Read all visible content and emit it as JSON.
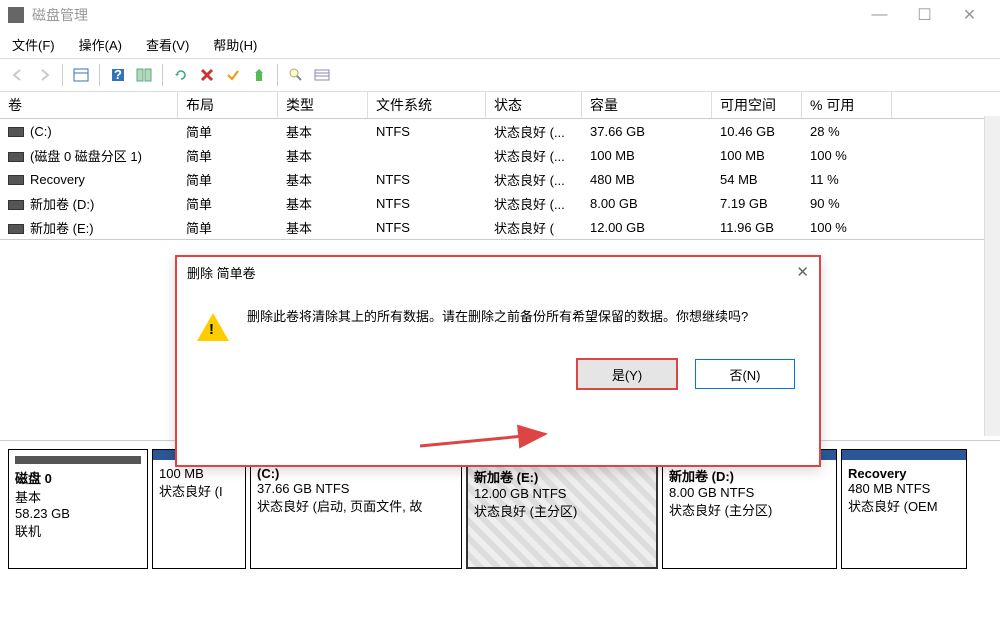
{
  "window": {
    "title": "磁盘管理"
  },
  "menu": {
    "file": "文件(F)",
    "action": "操作(A)",
    "view": "查看(V)",
    "help": "帮助(H)"
  },
  "columns": {
    "vol": "卷",
    "layout": "布局",
    "type": "类型",
    "fs": "文件系统",
    "status": "状态",
    "cap": "容量",
    "free": "可用空间",
    "pct": "% 可用"
  },
  "rows": [
    {
      "vol": "(C:)",
      "layout": "简单",
      "type": "基本",
      "fs": "NTFS",
      "status": "状态良好 (...",
      "cap": "37.66 GB",
      "free": "10.46 GB",
      "pct": "28 %"
    },
    {
      "vol": "(磁盘 0 磁盘分区 1)",
      "layout": "简单",
      "type": "基本",
      "fs": "",
      "status": "状态良好 (...",
      "cap": "100 MB",
      "free": "100 MB",
      "pct": "100 %"
    },
    {
      "vol": "Recovery",
      "layout": "简单",
      "type": "基本",
      "fs": "NTFS",
      "status": "状态良好 (...",
      "cap": "480 MB",
      "free": "54 MB",
      "pct": "11 %"
    },
    {
      "vol": "新加卷 (D:)",
      "layout": "简单",
      "type": "基本",
      "fs": "NTFS",
      "status": "状态良好 (...",
      "cap": "8.00 GB",
      "free": "7.19 GB",
      "pct": "90 %"
    },
    {
      "vol": "新加卷 (E:)",
      "layout": "简单",
      "type": "基本",
      "fs": "NTFS",
      "status": "状态良好 (",
      "cap": "12.00 GB",
      "free": "11.96 GB",
      "pct": "100 %"
    }
  ],
  "disk": {
    "label": "磁盘 0",
    "type": "基本",
    "size": "58.23 GB",
    "state": "联机",
    "parts": [
      {
        "title": "",
        "line1": "100 MB",
        "line2": "状态良好 (I"
      },
      {
        "title": "(C:)",
        "line1": "37.66 GB NTFS",
        "line2": "状态良好 (启动, 页面文件, 故"
      },
      {
        "title": "新加卷  (E:)",
        "line1": "12.00 GB NTFS",
        "line2": "状态良好 (主分区)"
      },
      {
        "title": "新加卷  (D:)",
        "line1": "8.00 GB NTFS",
        "line2": "状态良好 (主分区)"
      },
      {
        "title": "Recovery",
        "line1": "480 MB NTFS",
        "line2": "状态良好 (OEM"
      }
    ]
  },
  "dialog": {
    "title": "删除 简单卷",
    "message": "删除此卷将清除其上的所有数据。请在删除之前备份所有希望保留的数据。你想继续吗?",
    "yes": "是(Y)",
    "no": "否(N)"
  }
}
